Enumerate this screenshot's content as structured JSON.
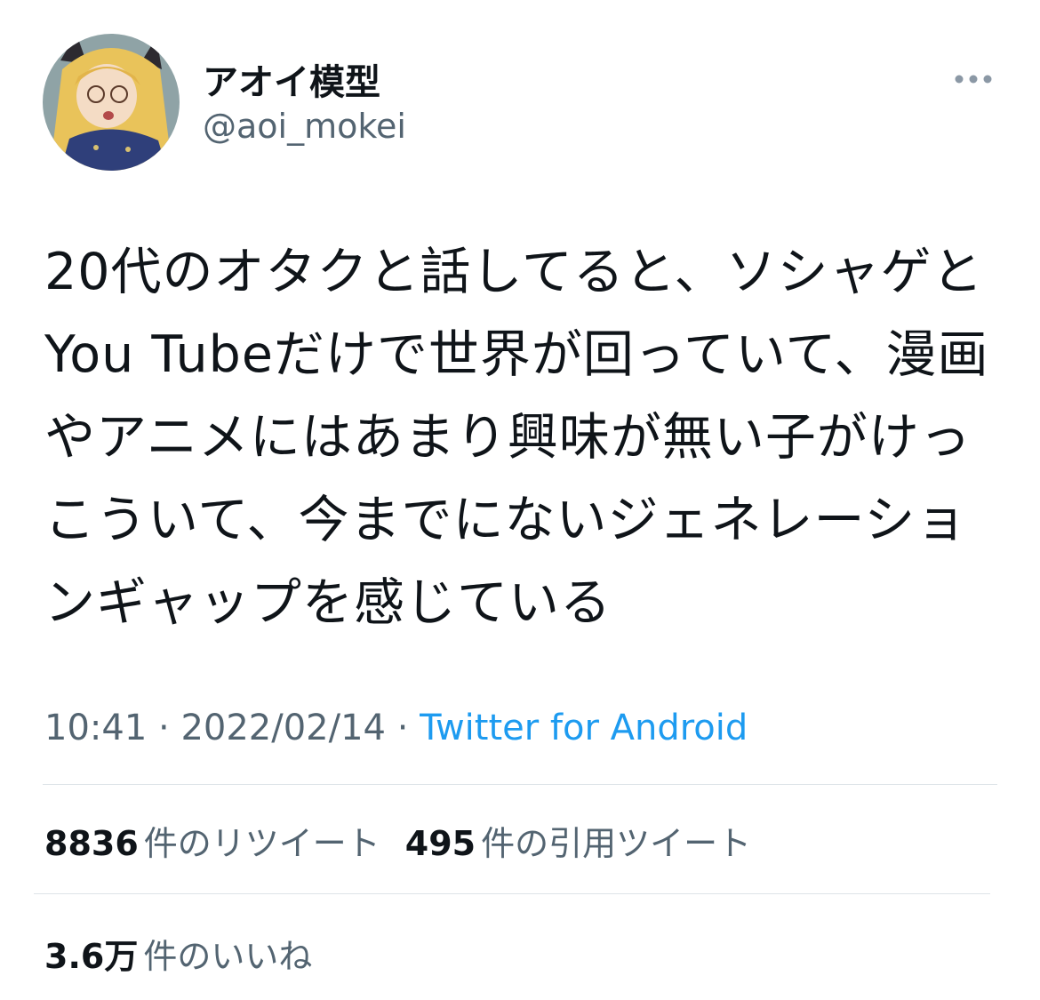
{
  "author": {
    "display_name": "アオイ模型",
    "handle": "@aoi_mokei",
    "avatar_icon": "figure-avatar-icon"
  },
  "tweet": {
    "text": "20代のオタクと話してると、ソシャゲとYou Tubeだけで世界が回っていて、漫画やアニメにはあまり興味が無い子がけっこういて、今までにないジェネレーションギャップを感じている",
    "time": "10:41",
    "separator": "·",
    "date": "2022/02/14",
    "source": "Twitter for Android"
  },
  "stats": {
    "retweets_count": "8836",
    "retweets_label": "件のリツイート",
    "quotes_count": "495",
    "quotes_label": "件の引用ツイート",
    "likes_count": "3.6万",
    "likes_label": "件のいいね"
  },
  "icons": {
    "more": "more-dots-icon"
  },
  "colors": {
    "text": "#0f1419",
    "secondary": "#536471",
    "link": "#1d9bf0",
    "divider": "#dde3e7"
  }
}
